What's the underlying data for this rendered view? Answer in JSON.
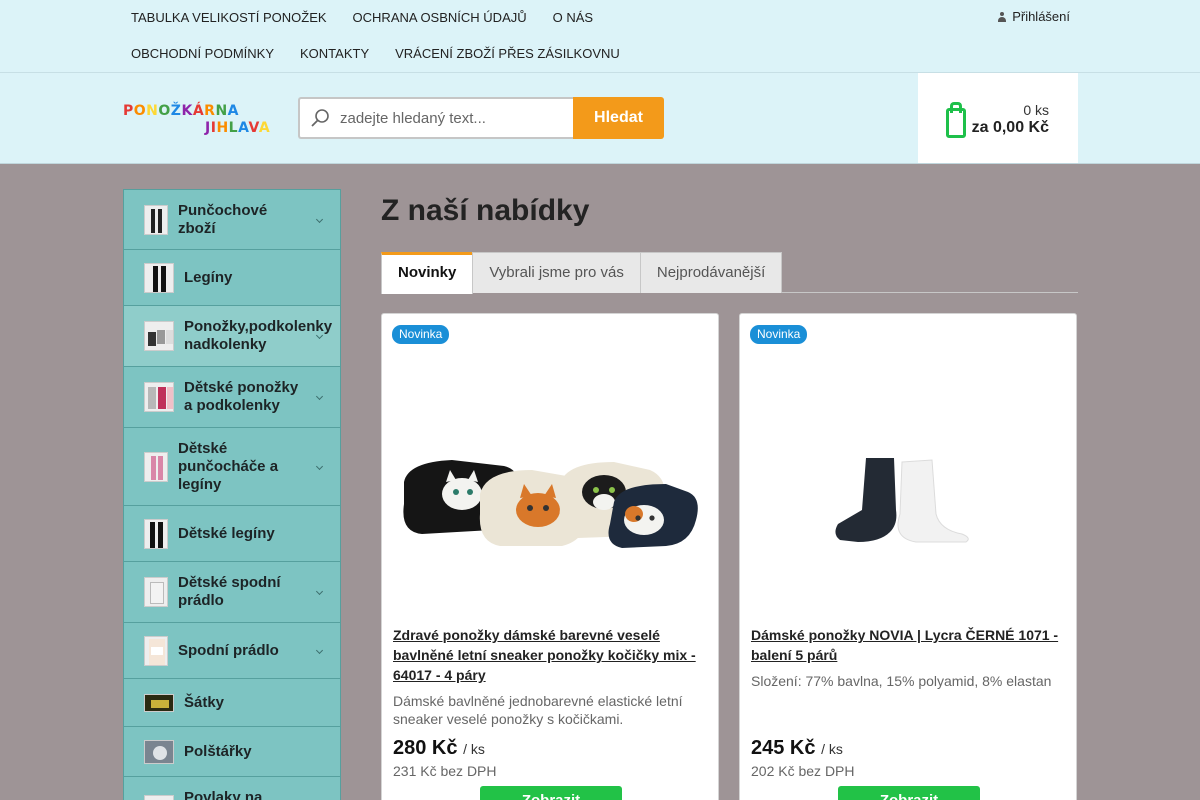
{
  "topnav": {
    "row1": [
      "TABULKA VELIKOSTÍ PONOŽEK",
      "OCHRANA OSBNÍCH ÚDAJŮ",
      "O NÁS"
    ],
    "row2": [
      "OBCHODNÍ PODMÍNKY",
      "KONTAKTY",
      "VRÁCENÍ ZBOŽÍ PŘES ZÁSILKOVNU"
    ],
    "login": "Přihlášení"
  },
  "header": {
    "logo_text_1": "PONOŽKÁRNA",
    "logo_text_2": "JIHLAVA",
    "search_placeholder": "zadejte hledaný text...",
    "search_button": "Hledat",
    "cart_count": "0 ks",
    "cart_total": "za 0,00 Kč"
  },
  "sidebar": {
    "items": [
      {
        "label": "Punčochové zboží",
        "has_sub": true
      },
      {
        "label": "Legíny",
        "has_sub": false
      },
      {
        "label": "Ponožky,podkolenky nadkolenky",
        "has_sub": true
      },
      {
        "label": "Dětské ponožky a podkolenky",
        "has_sub": true
      },
      {
        "label": "Dětské punčocháče a legíny",
        "has_sub": true
      },
      {
        "label": "Dětské legíny",
        "has_sub": false
      },
      {
        "label": "Dětské spodní prádlo",
        "has_sub": true
      },
      {
        "label": "Spodní prádlo",
        "has_sub": true
      },
      {
        "label": "Šátky",
        "has_sub": false
      },
      {
        "label": "Polštářky",
        "has_sub": false
      },
      {
        "label": "Povlaky na",
        "has_sub": false
      }
    ]
  },
  "main": {
    "title": "Z naší nabídky",
    "tabs": [
      "Novinky",
      "Vybrali jsme pro vás",
      "Nejprodávanější"
    ]
  },
  "products": [
    {
      "badge": "Novinka",
      "name": "Zdravé ponožky dámské barevné veselé bavlněné letní sneaker ponožky kočičky mix - 64017 - 4 páry",
      "desc": "Dámské bavlněné jednobarevné elastické letní sneaker veselé ponožky s kočičkami.",
      "price": "280 Kč",
      "unit": "/ ks",
      "price_net": "231 Kč bez DPH",
      "button": "Zobrazit"
    },
    {
      "badge": "Novinka",
      "name": "Dámské ponožky NOVIA | Lycra ČERNÉ 1071 - balení 5 párů",
      "desc": "Složení: 77% bavlna, 15% polyamid, 8% elastan",
      "price": "245 Kč",
      "unit": "/ ks",
      "price_net": "202 Kč bez DPH",
      "button": "Zobrazit"
    }
  ],
  "colors": {
    "accent": "#f39a1a",
    "cart_green": "#1ec04a",
    "sidebar": "#7dc4c2",
    "badge": "#1a8fd7"
  }
}
